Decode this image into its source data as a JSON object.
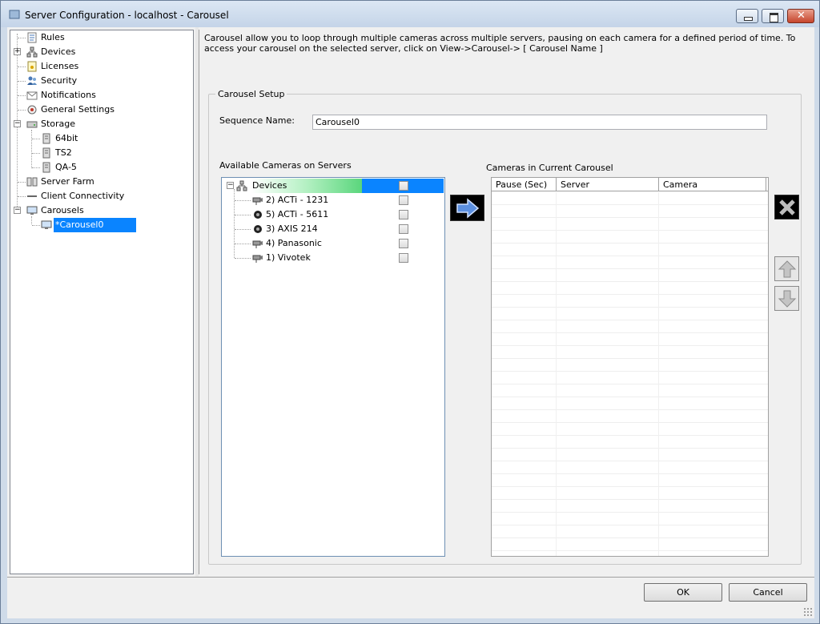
{
  "window": {
    "title": "Server Configuration - localhost - Carousel"
  },
  "left_tree": {
    "items": [
      {
        "label": "Rules",
        "icon": "rules-icon"
      },
      {
        "label": "Devices",
        "icon": "network-devices-icon"
      },
      {
        "label": "Licenses",
        "icon": "license-icon"
      },
      {
        "label": "Security",
        "icon": "users-icon"
      },
      {
        "label": "Notifications",
        "icon": "envelope-icon"
      },
      {
        "label": "General Settings",
        "icon": "settings-icon"
      },
      {
        "label": "Storage",
        "icon": "drive-icon"
      },
      {
        "label": "64bit",
        "icon": "storage-server-icon"
      },
      {
        "label": "TS2",
        "icon": "storage-server-icon"
      },
      {
        "label": "QA-5",
        "icon": "storage-server-icon"
      },
      {
        "label": "Server Farm",
        "icon": "server-farm-icon"
      },
      {
        "label": "Client Connectivity",
        "icon": "connection-icon"
      },
      {
        "label": "Carousels",
        "icon": "monitor-icon"
      },
      {
        "label": "*Carousel0",
        "icon": "monitor-icon"
      }
    ]
  },
  "main": {
    "description": "Carousel allow you to loop through multiple cameras across multiple servers, pausing on each camera for a defined period of time. To access your carousel on the selected server, click on View->Carousel-> [ Carousel Name ]",
    "group_title": "Carousel Setup",
    "sequence_label": "Sequence Name:",
    "sequence_value": "Carousel0",
    "available_label": "Available Cameras on Servers",
    "current_label": "Cameras in Current Carousel",
    "camera_tree": {
      "root": "Devices",
      "cameras": [
        {
          "label": "2) ACTi - 1231",
          "icon": "box-camera-icon"
        },
        {
          "label": "5) ACTi - 5611",
          "icon": "dome-camera-icon"
        },
        {
          "label": "3) AXIS 214",
          "icon": "dome-camera-icon"
        },
        {
          "label": "4) Panasonic",
          "icon": "box-camera-icon"
        },
        {
          "label": "1) Vivotek",
          "icon": "box-camera-icon"
        }
      ]
    },
    "grid_columns": [
      "Pause (Sec)",
      "Server",
      "Camera"
    ]
  },
  "buttons": {
    "ok": "OK",
    "cancel": "Cancel"
  },
  "colors": {
    "selection": "#0a84ff",
    "highlight_green": "#5ad67c",
    "titlebar": "#c4d4e8"
  }
}
